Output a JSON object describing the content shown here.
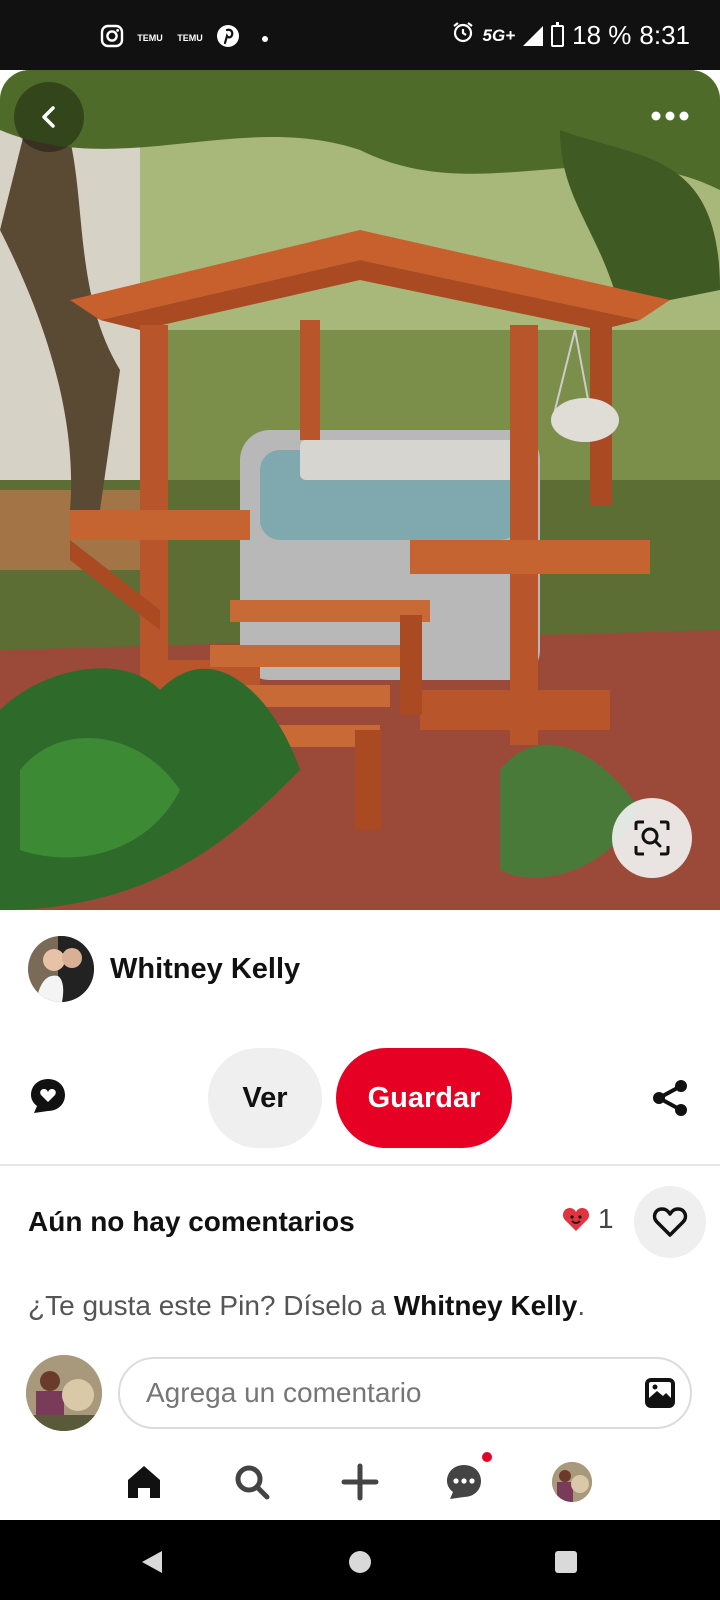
{
  "status_bar": {
    "time": "8:31",
    "battery": "18 %",
    "network": "5G+",
    "left_icons": [
      "instagram-icon",
      "temu-icon",
      "temu-icon",
      "pinterest-icon"
    ],
    "temu_label": "TEMU",
    "right_icons": [
      "alarm-icon",
      "signal-icon",
      "battery-icon"
    ]
  },
  "pin": {
    "author_name": "Whitney Kelly"
  },
  "actions": {
    "view_label": "Ver",
    "save_label": "Guardar"
  },
  "comments": {
    "title": "Aún no hay comentarios",
    "reaction_count": "1",
    "prompt_prefix": "¿Te gusta este Pin? Díselo a ",
    "prompt_name": "Whitney Kelly",
    "prompt_suffix": ".",
    "input_placeholder": "Agrega un comentario"
  },
  "colors": {
    "brand_red": "#e60023",
    "chip_gray": "#efefef"
  },
  "bottom_nav": [
    "home-icon",
    "search-icon",
    "create-icon",
    "messages-icon",
    "profile-avatar"
  ]
}
